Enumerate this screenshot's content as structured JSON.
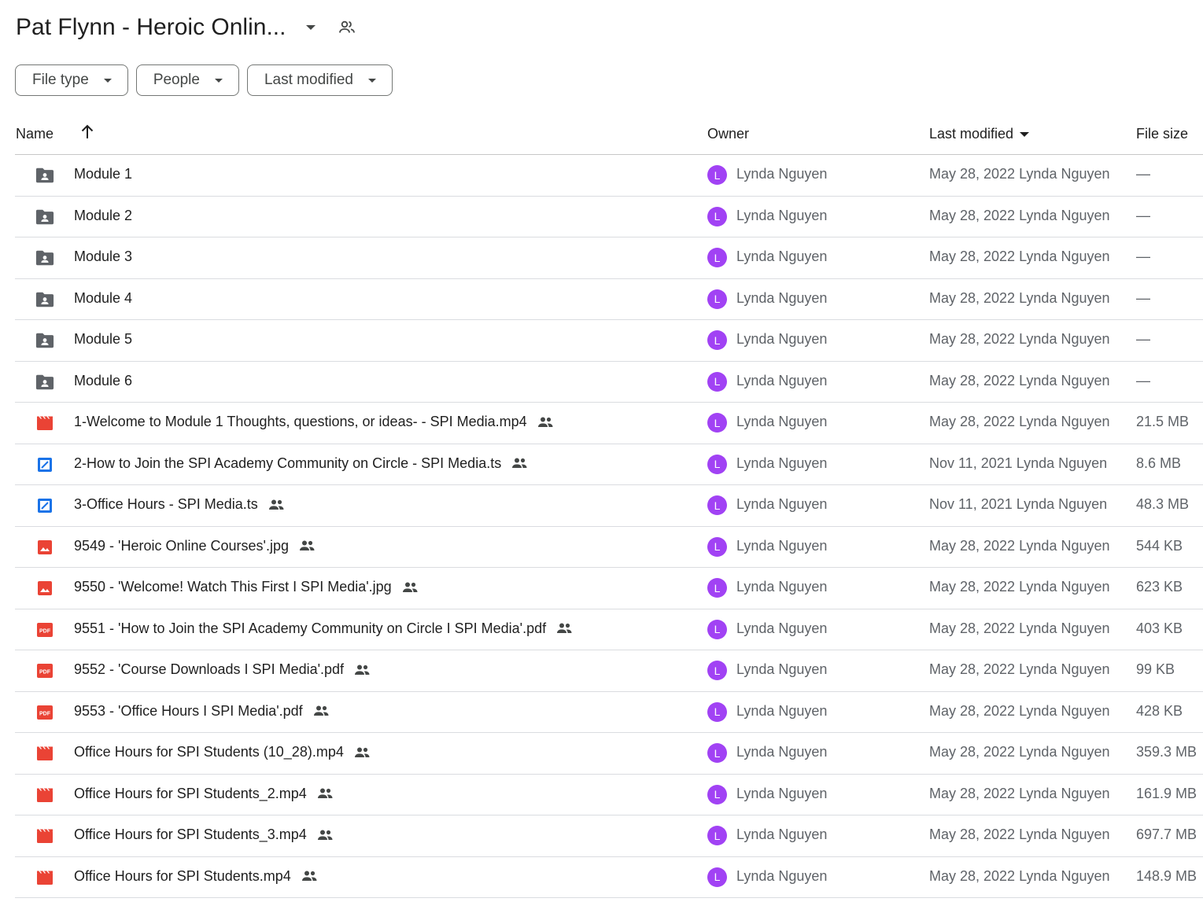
{
  "header": {
    "title": "Pat Flynn - Heroic Onlin..."
  },
  "filters": [
    {
      "label": "File type"
    },
    {
      "label": "People"
    },
    {
      "label": "Last modified"
    }
  ],
  "columns": {
    "name": "Name",
    "owner": "Owner",
    "last_modified": "Last modified",
    "file_size": "File size"
  },
  "files": [
    {
      "type": "folder",
      "name": "Module 1",
      "shared": false,
      "owner_initial": "L",
      "owner": "Lynda Nguyen",
      "modified": "May 28, 2022 Lynda Nguyen",
      "size": "—"
    },
    {
      "type": "folder",
      "name": "Module 2",
      "shared": false,
      "owner_initial": "L",
      "owner": "Lynda Nguyen",
      "modified": "May 28, 2022 Lynda Nguyen",
      "size": "—"
    },
    {
      "type": "folder",
      "name": "Module 3",
      "shared": false,
      "owner_initial": "L",
      "owner": "Lynda Nguyen",
      "modified": "May 28, 2022 Lynda Nguyen",
      "size": "—"
    },
    {
      "type": "folder",
      "name": "Module 4",
      "shared": false,
      "owner_initial": "L",
      "owner": "Lynda Nguyen",
      "modified": "May 28, 2022 Lynda Nguyen",
      "size": "—"
    },
    {
      "type": "folder",
      "name": "Module 5",
      "shared": false,
      "owner_initial": "L",
      "owner": "Lynda Nguyen",
      "modified": "May 28, 2022 Lynda Nguyen",
      "size": "—"
    },
    {
      "type": "folder",
      "name": "Module 6",
      "shared": false,
      "owner_initial": "L",
      "owner": "Lynda Nguyen",
      "modified": "May 28, 2022 Lynda Nguyen",
      "size": "—"
    },
    {
      "type": "video",
      "name": "1-Welcome to Module 1 Thoughts, questions, or ideas- - SPI Media.mp4",
      "shared": true,
      "owner_initial": "L",
      "owner": "Lynda Nguyen",
      "modified": "May 28, 2022 Lynda Nguyen",
      "size": "21.5 MB"
    },
    {
      "type": "ts",
      "name": "2-How to Join the SPI Academy Community on Circle - SPI Media.ts",
      "shared": true,
      "owner_initial": "L",
      "owner": "Lynda Nguyen",
      "modified": "Nov 11, 2021 Lynda Nguyen",
      "size": "8.6 MB"
    },
    {
      "type": "ts",
      "name": "3-Office Hours - SPI Media.ts",
      "shared": true,
      "owner_initial": "L",
      "owner": "Lynda Nguyen",
      "modified": "Nov 11, 2021 Lynda Nguyen",
      "size": "48.3 MB"
    },
    {
      "type": "image",
      "name": "9549 - 'Heroic Online Courses'.jpg",
      "shared": true,
      "owner_initial": "L",
      "owner": "Lynda Nguyen",
      "modified": "May 28, 2022 Lynda Nguyen",
      "size": "544 KB"
    },
    {
      "type": "image",
      "name": "9550 - 'Welcome! Watch This First I SPI Media'.jpg",
      "shared": true,
      "owner_initial": "L",
      "owner": "Lynda Nguyen",
      "modified": "May 28, 2022 Lynda Nguyen",
      "size": "623 KB"
    },
    {
      "type": "pdf",
      "name": "9551 - 'How to Join the SPI Academy Community on Circle I SPI Media'.pdf",
      "shared": true,
      "owner_initial": "L",
      "owner": "Lynda Nguyen",
      "modified": "May 28, 2022 Lynda Nguyen",
      "size": "403 KB"
    },
    {
      "type": "pdf",
      "name": "9552 - 'Course Downloads I SPI Media'.pdf",
      "shared": true,
      "owner_initial": "L",
      "owner": "Lynda Nguyen",
      "modified": "May 28, 2022 Lynda Nguyen",
      "size": "99 KB"
    },
    {
      "type": "pdf",
      "name": "9553 - 'Office Hours I SPI Media'.pdf",
      "shared": true,
      "owner_initial": "L",
      "owner": "Lynda Nguyen",
      "modified": "May 28, 2022 Lynda Nguyen",
      "size": "428 KB"
    },
    {
      "type": "video",
      "name": "Office Hours for SPI Students (10_28).mp4",
      "shared": true,
      "owner_initial": "L",
      "owner": "Lynda Nguyen",
      "modified": "May 28, 2022 Lynda Nguyen",
      "size": "359.3 MB"
    },
    {
      "type": "video",
      "name": "Office Hours for SPI Students_2.mp4",
      "shared": true,
      "owner_initial": "L",
      "owner": "Lynda Nguyen",
      "modified": "May 28, 2022 Lynda Nguyen",
      "size": "161.9 MB"
    },
    {
      "type": "video",
      "name": "Office Hours for SPI Students_3.mp4",
      "shared": true,
      "owner_initial": "L",
      "owner": "Lynda Nguyen",
      "modified": "May 28, 2022 Lynda Nguyen",
      "size": "697.7 MB"
    },
    {
      "type": "video",
      "name": "Office Hours for SPI Students.mp4",
      "shared": true,
      "owner_initial": "L",
      "owner": "Lynda Nguyen",
      "modified": "May 28, 2022 Lynda Nguyen",
      "size": "148.9 MB"
    }
  ],
  "icons": {
    "folder": "shared-folder-icon",
    "video": "video-file-icon",
    "ts": "ts-file-icon",
    "image": "image-file-icon",
    "pdf": "pdf-file-icon",
    "shared": "shared-people-icon",
    "sort": "arrow-up-icon"
  },
  "colors": {
    "folder": "#5f6368",
    "video": "#ea4335",
    "image": "#ea4335",
    "pdf": "#ea4335",
    "ts": "#1a73e8",
    "avatar": "#a142f4"
  }
}
